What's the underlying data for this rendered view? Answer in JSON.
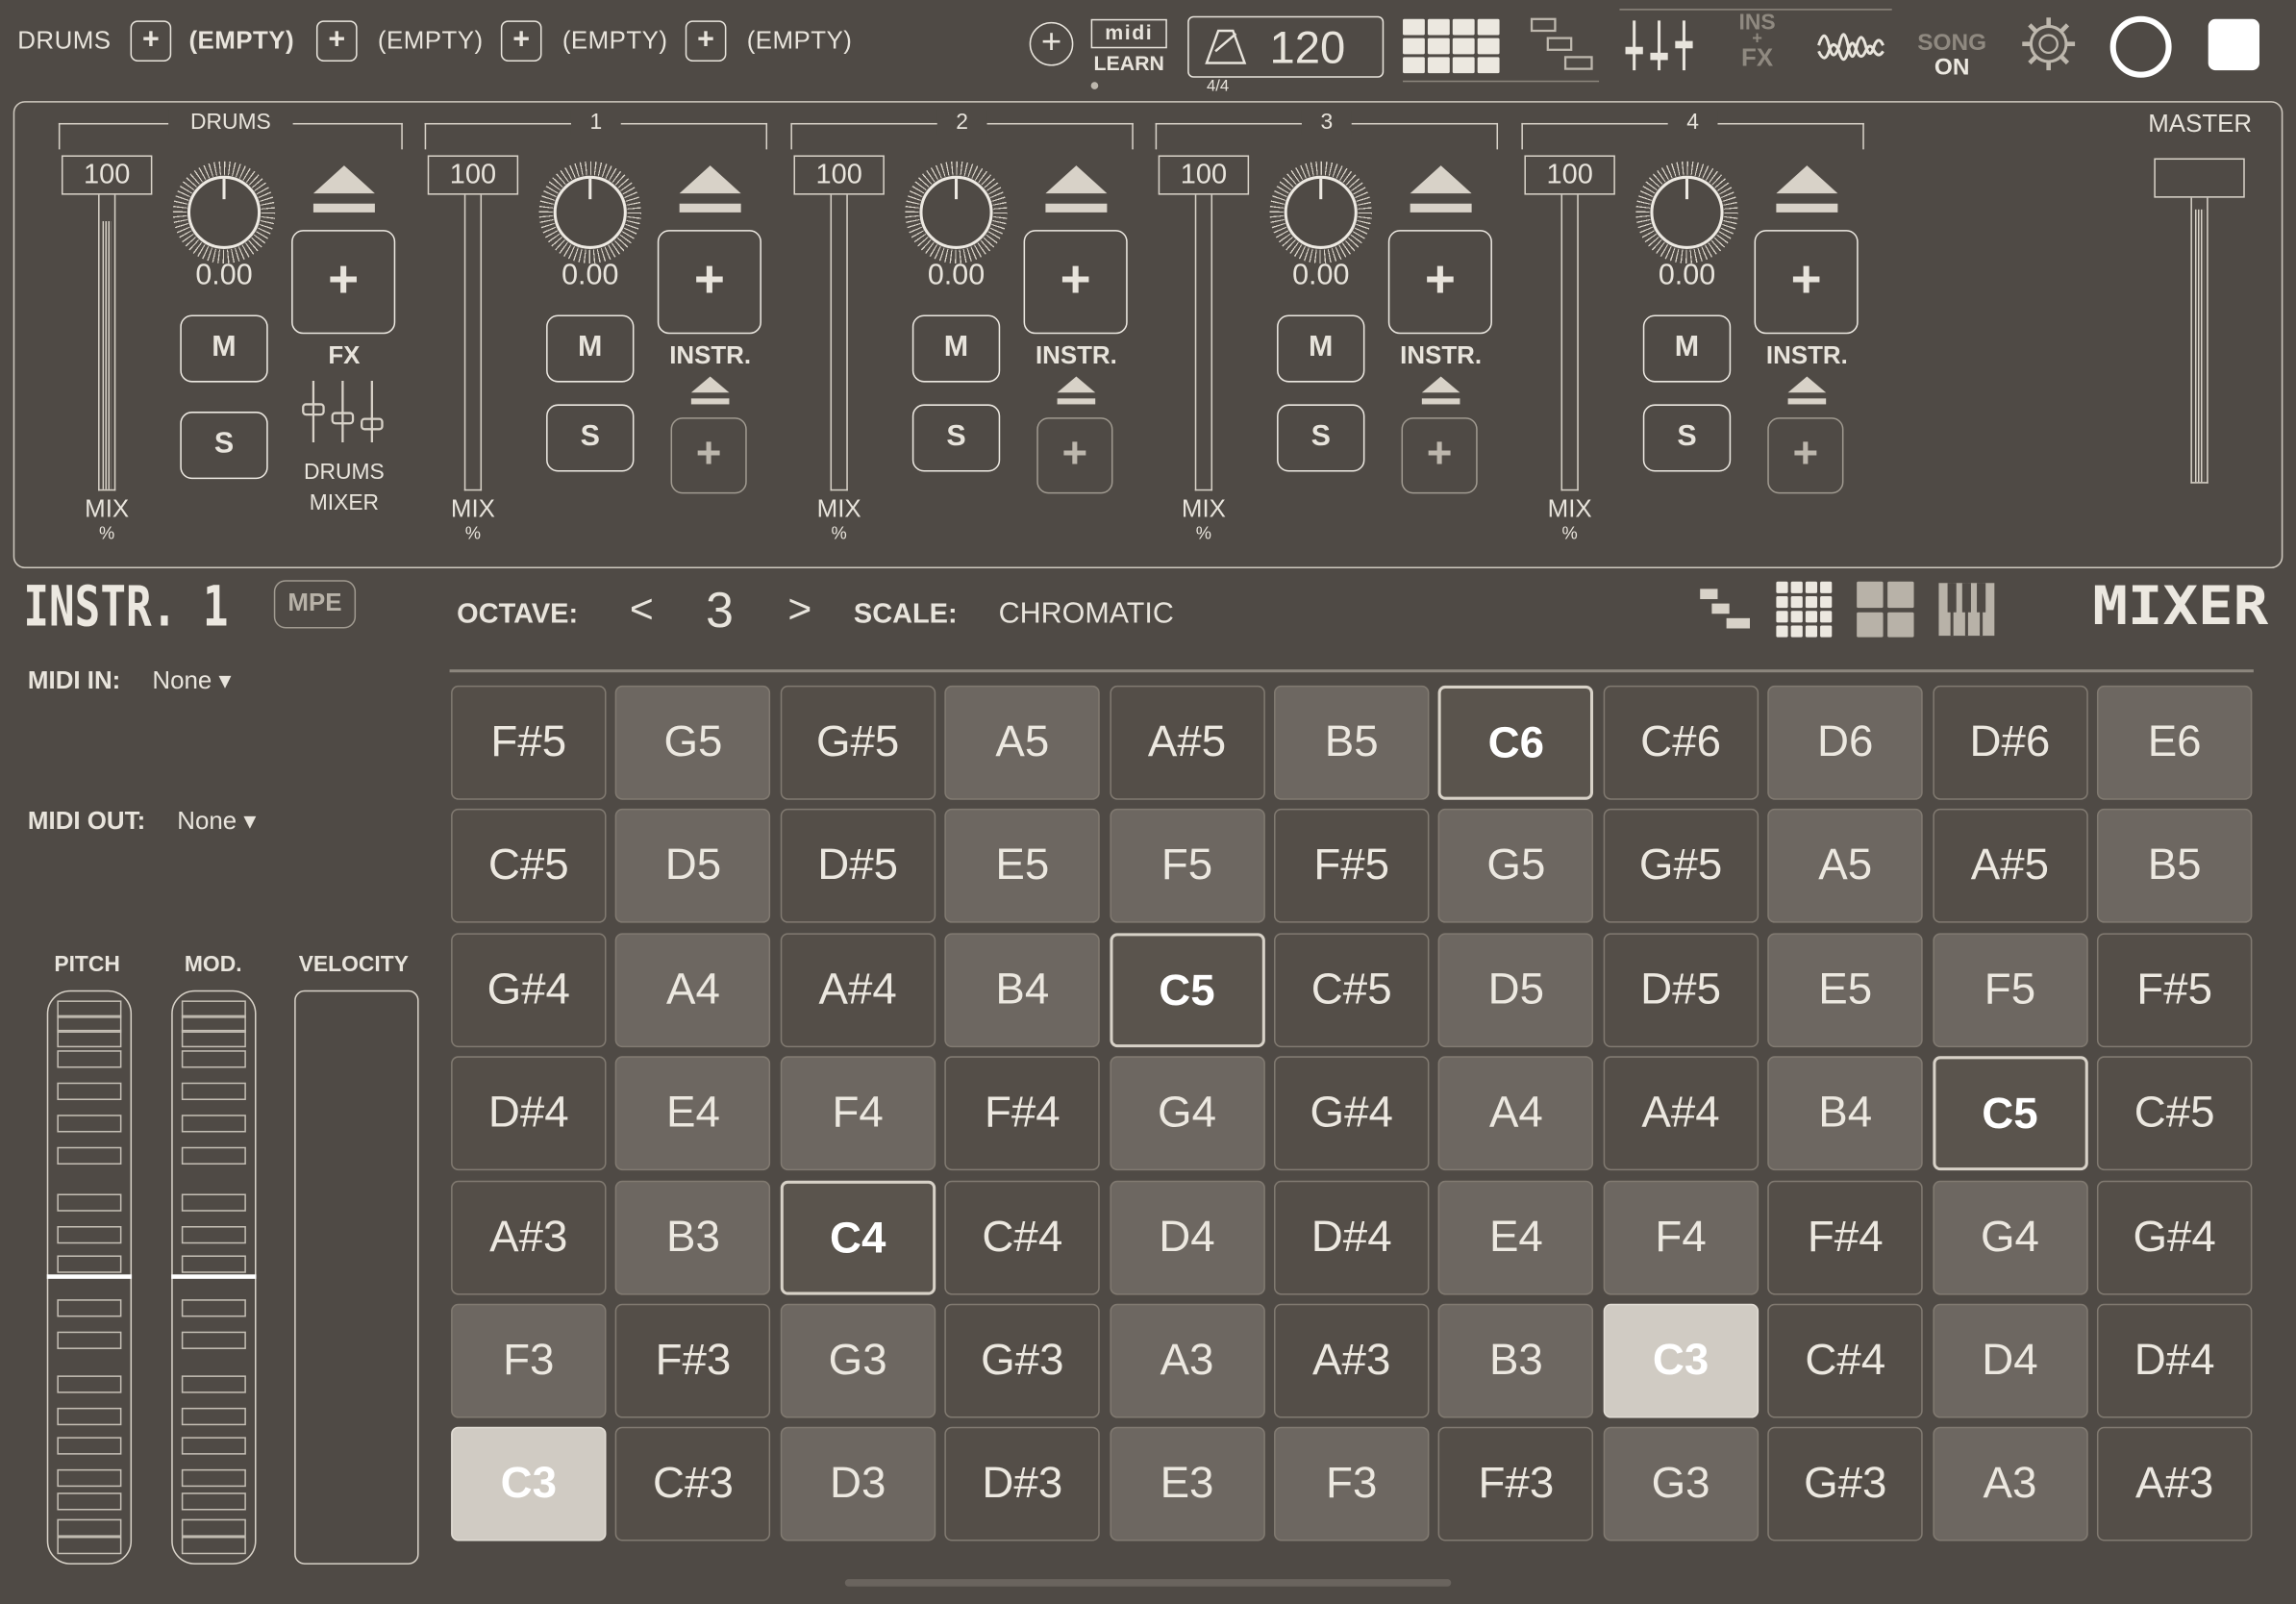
{
  "topbar": {
    "tracks": [
      {
        "label": "DRUMS",
        "slot": "(EMPTY)",
        "slot_bold": true
      },
      {
        "slot": "(EMPTY)"
      },
      {
        "slot": "(EMPTY)"
      },
      {
        "slot": "(EMPTY)"
      }
    ],
    "midi_learn": {
      "logo": "midi",
      "label": "LEARN"
    },
    "tempo": {
      "value": "120",
      "time_signature": "4/4"
    },
    "ins_fx": {
      "top": "INS",
      "plus": "+",
      "bottom": "FX"
    },
    "song": {
      "top": "SONG",
      "bottom": "ON"
    }
  },
  "mixer": {
    "channels": [
      {
        "title": "DRUMS",
        "volume": "100",
        "pan": "0.00",
        "mute": "M",
        "solo": "S",
        "slot_label": "FX",
        "extra_label_1": "DRUMS",
        "extra_label_2": "MIXER",
        "mix_label": "MIX",
        "mix_unit": "%"
      },
      {
        "title": "1",
        "volume": "100",
        "pan": "0.00",
        "mute": "M",
        "solo": "S",
        "slot_label": "INSTR.",
        "mix_label": "MIX",
        "mix_unit": "%"
      },
      {
        "title": "2",
        "volume": "100",
        "pan": "0.00",
        "mute": "M",
        "solo": "S",
        "slot_label": "INSTR.",
        "mix_label": "MIX",
        "mix_unit": "%"
      },
      {
        "title": "3",
        "volume": "100",
        "pan": "0.00",
        "mute": "M",
        "solo": "S",
        "slot_label": "INSTR.",
        "mix_label": "MIX",
        "mix_unit": "%"
      },
      {
        "title": "4",
        "volume": "100",
        "pan": "0.00",
        "mute": "M",
        "solo": "S",
        "slot_label": "INSTR.",
        "mix_label": "MIX",
        "mix_unit": "%"
      }
    ],
    "master_label": "MASTER",
    "plus_glyph": "+"
  },
  "instrument": {
    "title": "INSTR. 1",
    "mpe": "MPE",
    "octave_label": "OCTAVE:",
    "octave_value": "3",
    "octave_prev": "<",
    "octave_next": ">",
    "scale_label": "SCALE:",
    "scale_value": "CHROMATIC",
    "mixer_label": "MIXER",
    "midi_in_label": "MIDI IN:",
    "midi_in_value": "None ▾",
    "midi_out_label": "MIDI OUT:",
    "midi_out_value": "None ▾",
    "pitch_label": "PITCH",
    "mod_label": "MOD.",
    "velocity_label": "VELOCITY"
  },
  "pads": [
    [
      "F#5",
      "G5",
      "G#5",
      "A5",
      "A#5",
      "B5",
      "C6",
      "C#6",
      "D6",
      "D#6",
      "E6"
    ],
    [
      "C#5",
      "D5",
      "D#5",
      "E5",
      "F5",
      "F#5",
      "G5",
      "G#5",
      "A5",
      "A#5",
      "B5"
    ],
    [
      "G#4",
      "A4",
      "A#4",
      "B4",
      "C5",
      "C#5",
      "D5",
      "D#5",
      "E5",
      "F5",
      "F#5"
    ],
    [
      "D#4",
      "E4",
      "F4",
      "F#4",
      "G4",
      "G#4",
      "A4",
      "A#4",
      "B4",
      "C5",
      "C#5"
    ],
    [
      "A#3",
      "B3",
      "C4",
      "C#4",
      "D4",
      "D#4",
      "E4",
      "F4",
      "F#4",
      "G4",
      "G#4"
    ],
    [
      "F3",
      "F#3",
      "G3",
      "G#3",
      "A3",
      "A#3",
      "B3",
      "C3",
      "C#4",
      "D4",
      "D#4"
    ],
    [
      "C3",
      "C#3",
      "D3",
      "D#3",
      "E3",
      "F3",
      "F#3",
      "G3",
      "G#3",
      "A3",
      "A#3"
    ]
  ],
  "pad_styles": [
    [
      "dark",
      "mid",
      "dark",
      "mid",
      "dark",
      "mid",
      "c",
      "dark",
      "mid",
      "dark",
      "mid"
    ],
    [
      "dark",
      "mid",
      "dark",
      "mid",
      "mid",
      "dark",
      "mid",
      "dark",
      "mid",
      "dark",
      "mid"
    ],
    [
      "dark",
      "mid",
      "dark",
      "mid",
      "c",
      "dark",
      "mid",
      "dark",
      "mid",
      "mid",
      "dark"
    ],
    [
      "dark",
      "mid",
      "mid",
      "dark",
      "mid",
      "dark",
      "mid",
      "dark",
      "mid",
      "c",
      "dark"
    ],
    [
      "dark",
      "mid",
      "c",
      "dark",
      "mid",
      "dark",
      "mid",
      "mid",
      "dark",
      "mid",
      "dark"
    ],
    [
      "mid",
      "dark",
      "mid",
      "dark",
      "mid",
      "dark",
      "mid",
      "act",
      "dark",
      "mid",
      "dark"
    ],
    [
      "act",
      "dark",
      "mid",
      "dark",
      "mid",
      "mid",
      "dark",
      "mid",
      "dark",
      "mid",
      "dark"
    ]
  ]
}
